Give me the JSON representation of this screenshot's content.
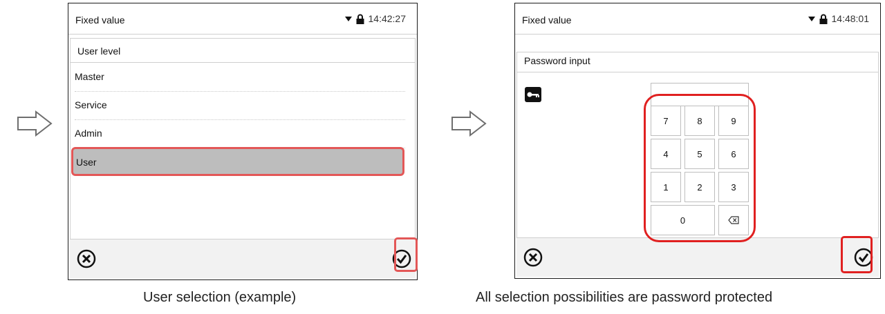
{
  "left_screen": {
    "title": "Fixed value",
    "time": "14:42:27",
    "panel_title": "User level",
    "items": [
      {
        "label": "Master"
      },
      {
        "label": "Service"
      },
      {
        "label": "Admin"
      },
      {
        "label": "User"
      }
    ],
    "selected_item": "User",
    "cancel_icon": "circle-x-icon",
    "confirm_icon": "circle-check-icon",
    "caption": "User selection (example)"
  },
  "right_screen": {
    "title": "Fixed value",
    "time": "14:48:01",
    "panel_title": "Password input",
    "password_value": "",
    "keypad": {
      "keys": [
        {
          "label": "7"
        },
        {
          "label": "8"
        },
        {
          "label": "9"
        },
        {
          "label": "4"
        },
        {
          "label": "5"
        },
        {
          "label": "6"
        },
        {
          "label": "1"
        },
        {
          "label": "2"
        },
        {
          "label": "3"
        },
        {
          "label": "0"
        }
      ],
      "backspace_icon": "backspace-icon"
    },
    "key_icon": "key-icon",
    "cancel_icon": "circle-x-icon",
    "confirm_icon": "circle-check-icon",
    "caption": "All selection possibilities are password protected"
  },
  "icons": {
    "flow_arrow": "right-arrow-icon",
    "dropdown": "triangle-down-icon",
    "lock": "lock-icon"
  },
  "colors": {
    "highlight_red": "#e02020",
    "highlight_soft_red": "#e35757",
    "selected_row_bg": "#bdbdbd",
    "bottom_bar_bg": "#f2f2f2"
  }
}
